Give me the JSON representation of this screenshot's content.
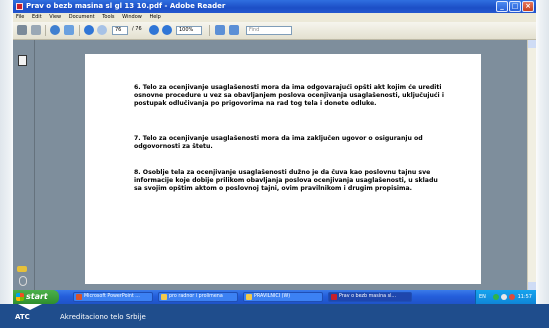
{
  "window": {
    "title": "Prav o bezb masina sl gl 13 10.pdf - Adobe Reader",
    "buttons": [
      "_",
      "□",
      "×"
    ]
  },
  "menu": [
    "File",
    "Edit",
    "View",
    "Document",
    "Tools",
    "Window",
    "Help"
  ],
  "toolbar": {
    "page_current": "76",
    "page_total": "/ 76",
    "zoom": "100%",
    "find_placeholder": "Find"
  },
  "document": {
    "paragraphs": [
      "6. Telo za ocenjivanje usaglašenosti mora da ima odgovarajući opšti akt kojim će urediti osnovne procedure u vez sa obavljanjem poslova ocenjivanja usaglašenosti, uključujući i postupak odlučivanja po prigovorima na rad tog tela i donete odluke.",
      "7. Telo za ocenjivanje usaglašenosti mora da ima zaključen ugovor o osiguranju od odgovornosti za štetu.",
      "8. Osoblje tela za ocenjivanje usaglašenosti dužno je da čuva kao poslovnu tajnu sve informacije koje dobije prilikom obavljanja poslova ocenjivanja usaglašenosti, u skladu sa svojim opštim aktom o poslovnoj tajni, ovim pravilnikom i drugim propisima."
    ]
  },
  "taskbar": {
    "start_label": "start",
    "tasks": [
      {
        "label": "Microsoft PowerPoint ...",
        "color": "#d9532b"
      },
      {
        "label": "pro radnor i prolimena",
        "color": "#f2c94c"
      },
      {
        "label": "PRAVILNICI (W)",
        "color": "#f2c94c"
      },
      {
        "label": "Prav o bezb masina sl...",
        "color": "#c8202b"
      }
    ],
    "lang": "EN",
    "clock": "11:57"
  },
  "footer": {
    "abbr": "ATC",
    "org": "Akreditaciono telo Srbije"
  }
}
